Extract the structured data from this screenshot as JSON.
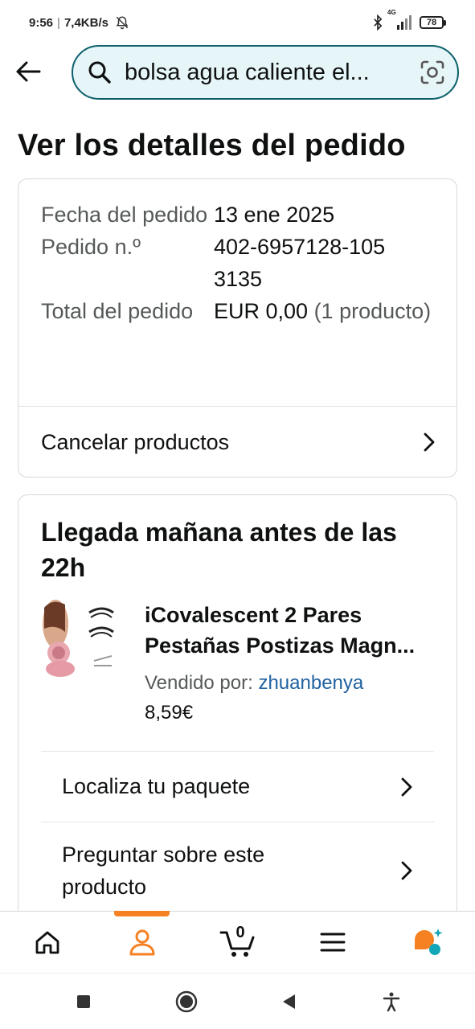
{
  "status_bar": {
    "time": "9:56",
    "network_speed": "7,4KB/s",
    "signal_type": "4G",
    "battery": "78"
  },
  "search": {
    "query": "bolsa agua caliente el..."
  },
  "page": {
    "title": "Ver los detalles del pedido"
  },
  "order_summary": {
    "rows": [
      {
        "label": "Fecha del pedido",
        "value": "13 ene 2025",
        "value_extra": ""
      },
      {
        "label": "Pedido n.º",
        "value": "402-6957128-1053135",
        "value_extra": ""
      },
      {
        "label": "Total del pedido",
        "value": "EUR 0,00",
        "value_extra": " (1 producto)"
      }
    ],
    "cancel_label": "Cancelar productos"
  },
  "shipment": {
    "title": "Llegada mañana antes de las 22h",
    "product": {
      "title": "iCovalescent 2 Pares Pestañas Postizas Magn...",
      "seller_prefix": "Vendido por: ",
      "seller_name": "zhuanbenya",
      "price": "8,59€"
    },
    "actions": [
      {
        "label": "Localiza tu paquete"
      },
      {
        "label": "Preguntar sobre este producto"
      }
    ]
  },
  "bottom_nav": {
    "items": [
      "home-icon",
      "account-icon",
      "cart-icon",
      "menu-icon",
      "rufus-icon"
    ],
    "cart_count": "0",
    "active_color": "#f68123"
  },
  "colors": {
    "search_border": "#0b5f6b",
    "search_bg": "#e6f6f8",
    "link": "#2162a1",
    "accent": "#f68123"
  }
}
